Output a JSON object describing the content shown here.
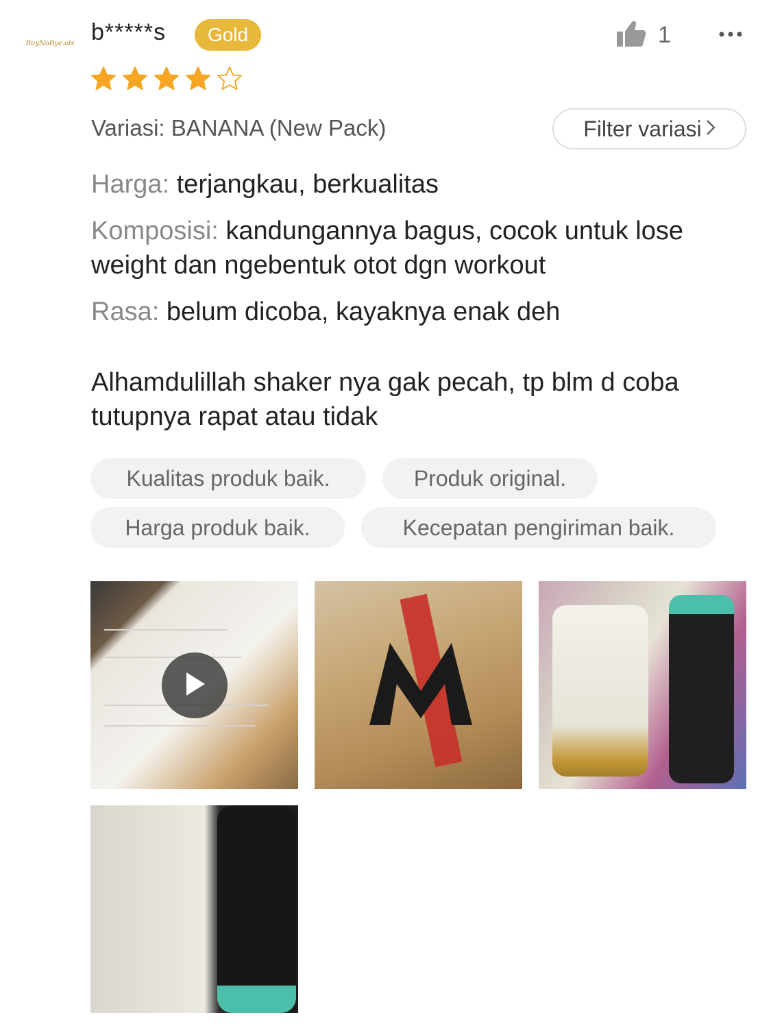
{
  "avatar": {
    "text": "BuyNoBye.ols"
  },
  "user": {
    "name": "b*****s",
    "badge": "Gold",
    "badge_color": "#e8b83a"
  },
  "likes": {
    "count": "1",
    "icon": "thumbs-up-icon"
  },
  "more_icon": "more-dots-icon",
  "rating": {
    "value": 4,
    "max": 5,
    "color": "#f5a623"
  },
  "variant": {
    "label": "Variasi: BANANA (New Pack)"
  },
  "filter": {
    "label": "Filter variasi",
    "icon": "chevron-right-icon"
  },
  "review": {
    "harga_key": "Harga:",
    "harga_val": "terjangkau, berkualitas",
    "komposisi_key": "Komposisi:",
    "komposisi_val": "kandungannya bagus, cocok untuk lose weight dan ngebentuk otot dgn workout",
    "rasa_key": "Rasa:",
    "rasa_val": "belum dicoba, kayaknya enak deh",
    "body": "Alhamdulillah shaker nya gak pecah, tp blm d coba tutupnya rapat atau tidak"
  },
  "tags": [
    "Kualitas produk baik.",
    "Produk original.",
    "Harga produk baik.",
    "Kecepatan pengiriman baik."
  ],
  "media": [
    {
      "type": "video",
      "icon": "play-icon"
    },
    {
      "type": "photo"
    },
    {
      "type": "photo"
    },
    {
      "type": "photo"
    }
  ]
}
